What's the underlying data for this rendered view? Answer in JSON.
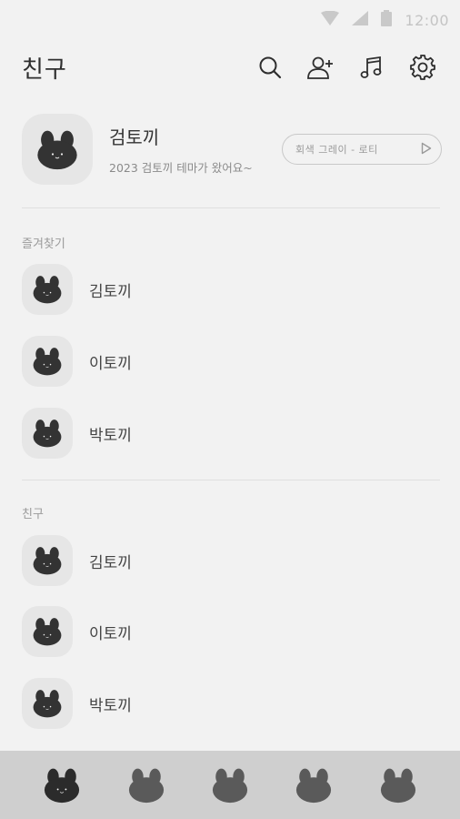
{
  "status_bar": {
    "time": "12:00",
    "icons": [
      "wifi-icon",
      "signal-icon",
      "battery-icon"
    ]
  },
  "header": {
    "title": "친구",
    "icons": [
      "search-icon",
      "add-friend-icon",
      "music-icon",
      "settings-icon"
    ]
  },
  "profile": {
    "name": "검토끼",
    "status": "2023 검토끼 테마가 왔어요~",
    "music": "회색 그레이 - 로티",
    "avatar_icon": "rabbit-icon"
  },
  "sections": {
    "favorites": {
      "label": "즐겨찾기",
      "items": [
        {
          "name": "김토끼"
        },
        {
          "name": "이토끼"
        },
        {
          "name": "박토끼"
        }
      ]
    },
    "friends": {
      "label": "친구",
      "items": [
        {
          "name": "김토끼"
        },
        {
          "name": "이토끼"
        },
        {
          "name": "박토끼"
        }
      ]
    }
  },
  "tab_bar": {
    "tabs": [
      "tab-friends",
      "tab-chats",
      "tab-view",
      "tab-shopping",
      "tab-more"
    ],
    "selected_tab": "tab-friends"
  },
  "colors": {
    "background": "#f2f2f2",
    "avatar_bg": "#e6e6e6",
    "rabbit": "#333333",
    "tab_bar_bg": "#cfcfcf",
    "tab_active": "#2b2b2b",
    "tab_inactive": "#5a5a5a"
  }
}
